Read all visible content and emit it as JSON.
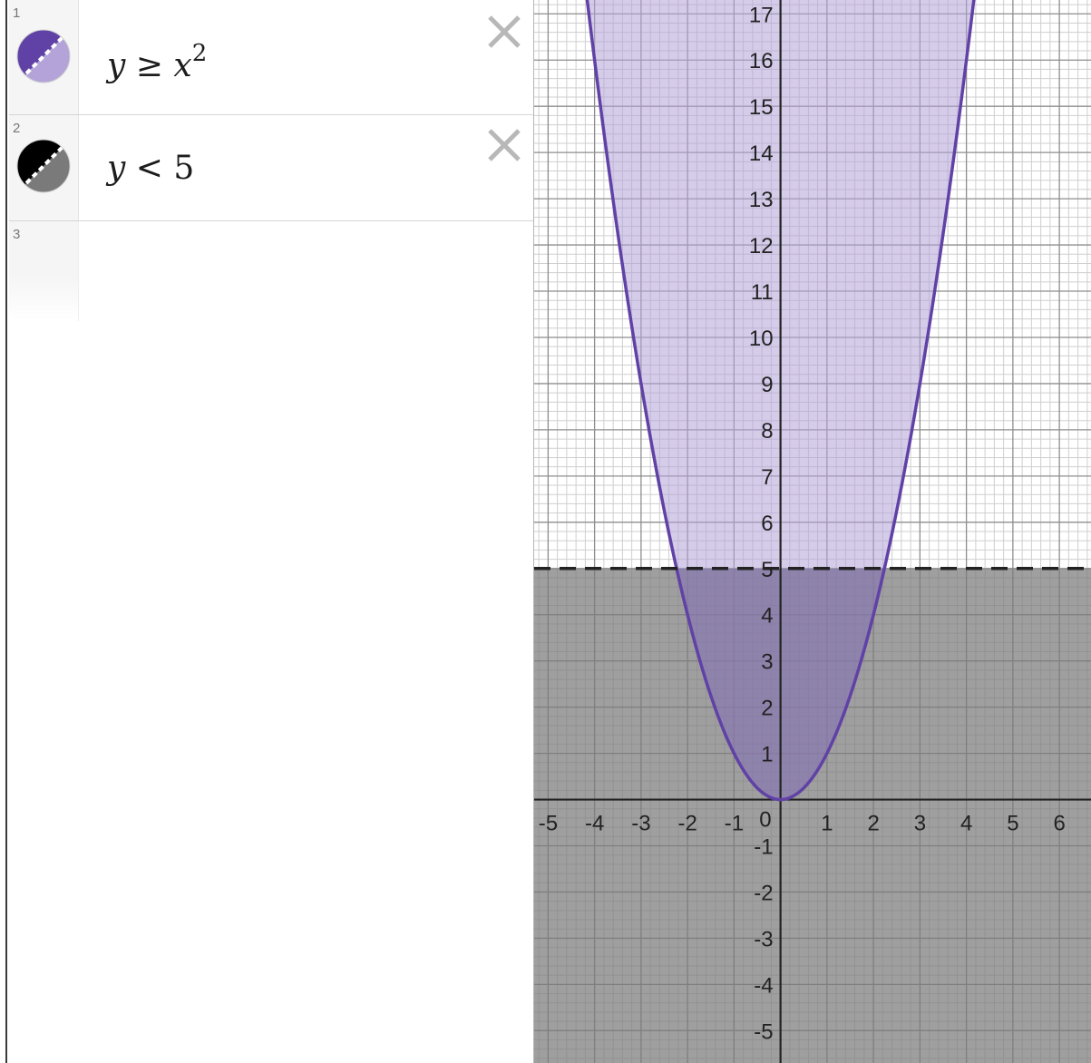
{
  "expressions": [
    {
      "index": "1",
      "lhs": "y",
      "op": "≥",
      "rhs": "x",
      "exponent": "2",
      "color": "#6042a6",
      "fill_color": "#b3a3d8",
      "icon": "dashed-inequality-color-icon"
    },
    {
      "index": "2",
      "lhs": "y",
      "op": "<",
      "rhs": "5",
      "color": "#000000",
      "fill_color": "#7a7a7a",
      "icon": "dashed-inequality-color-icon"
    },
    {
      "index": "3"
    }
  ],
  "delete_icon": "close-icon",
  "graph": {
    "x_range": [
      -5.3,
      6.7
    ],
    "y_range": [
      -5.7,
      17.3
    ],
    "x_ticks": [
      "-5",
      "-4",
      "-3",
      "-2",
      "-1",
      "1",
      "2",
      "3",
      "4",
      "5",
      "6"
    ],
    "y_ticks": [
      "-5",
      "-4",
      "-3",
      "-2",
      "-1",
      "1",
      "2",
      "3",
      "4",
      "5",
      "6",
      "7",
      "8",
      "9",
      "10",
      "11",
      "12",
      "13",
      "14",
      "15",
      "16",
      "17"
    ],
    "origin_label": "0",
    "minor_grid": 5,
    "boundary_line": 5,
    "colors": {
      "purple": "#6042a6",
      "purple_fill": "#b3a3d8",
      "gray_fill": "#7a7a7a",
      "overlap_fill": "#5b4b86",
      "grid_major": "#8e8e8e",
      "grid_minor": "#cfcfcf",
      "axis": "#222222"
    }
  }
}
